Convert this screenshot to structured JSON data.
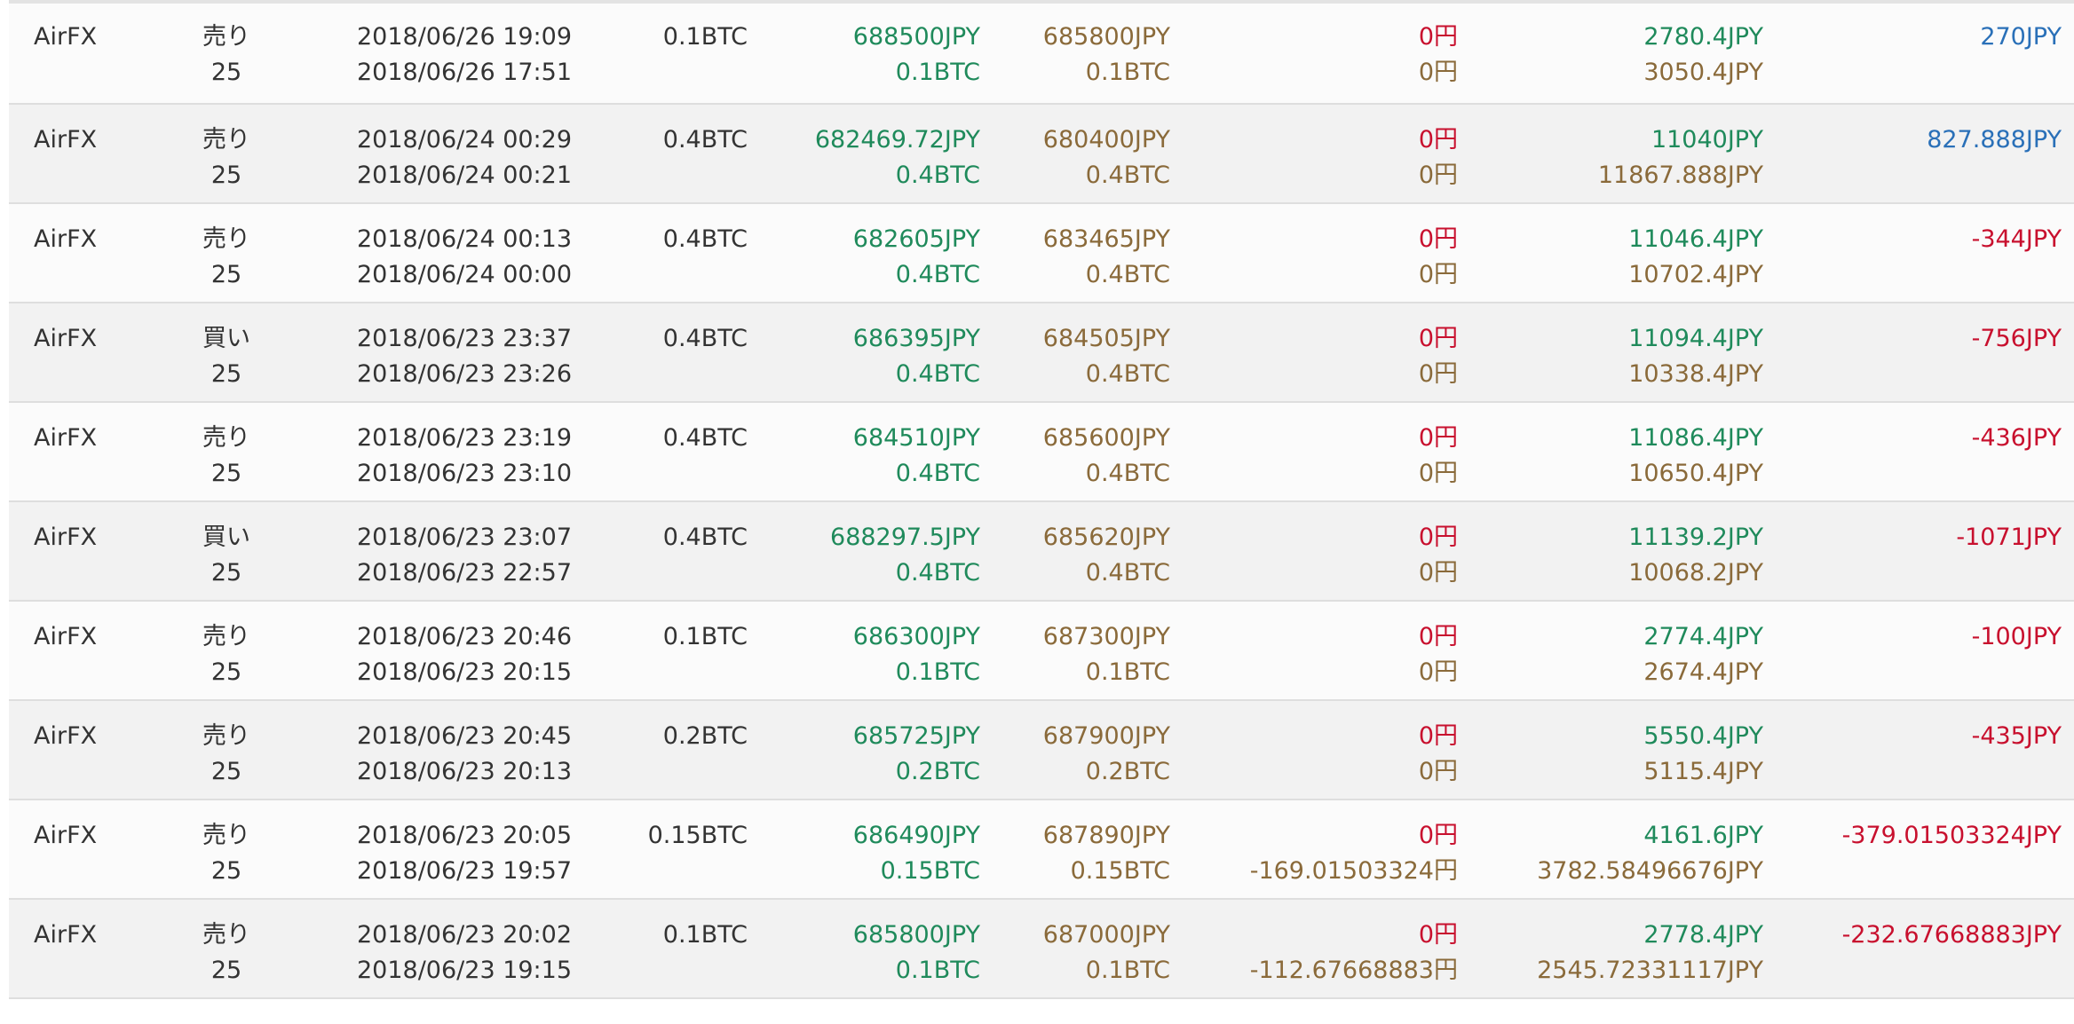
{
  "colors": {
    "text": "#333333",
    "green": "#1f8a5b",
    "brown": "#8a6a3a",
    "red": "#c8102e",
    "blue": "#2a70b8",
    "row_odd": "#fbfbfb",
    "row_even": "#f2f2f2",
    "divider": "#dedede"
  },
  "rows": [
    {
      "exchange": "AirFX",
      "side": "売り",
      "leverage": "25",
      "date_close": "2018/06/26 19:09",
      "date_open": "2018/06/26 17:51",
      "amount": "0.1BTC",
      "price_open": "688500JPY",
      "amount_open": "0.1BTC",
      "price_close": "685800JPY",
      "amount_close": "0.1BTC",
      "fee": "0円",
      "swap": "0円",
      "value_open": "2780.4JPY",
      "value_close": "3050.4JPY",
      "pnl": "270JPY",
      "pnl_sign": "positive"
    },
    {
      "exchange": "AirFX",
      "side": "売り",
      "leverage": "25",
      "date_close": "2018/06/24 00:29",
      "date_open": "2018/06/24 00:21",
      "amount": "0.4BTC",
      "price_open": "682469.72JPY",
      "amount_open": "0.4BTC",
      "price_close": "680400JPY",
      "amount_close": "0.4BTC",
      "fee": "0円",
      "swap": "0円",
      "value_open": "11040JPY",
      "value_close": "11867.888JPY",
      "pnl": "827.888JPY",
      "pnl_sign": "positive"
    },
    {
      "exchange": "AirFX",
      "side": "売り",
      "leverage": "25",
      "date_close": "2018/06/24 00:13",
      "date_open": "2018/06/24 00:00",
      "amount": "0.4BTC",
      "price_open": "682605JPY",
      "amount_open": "0.4BTC",
      "price_close": "683465JPY",
      "amount_close": "0.4BTC",
      "fee": "0円",
      "swap": "0円",
      "value_open": "11046.4JPY",
      "value_close": "10702.4JPY",
      "pnl": "-344JPY",
      "pnl_sign": "negative"
    },
    {
      "exchange": "AirFX",
      "side": "買い",
      "leverage": "25",
      "date_close": "2018/06/23 23:37",
      "date_open": "2018/06/23 23:26",
      "amount": "0.4BTC",
      "price_open": "686395JPY",
      "amount_open": "0.4BTC",
      "price_close": "684505JPY",
      "amount_close": "0.4BTC",
      "fee": "0円",
      "swap": "0円",
      "value_open": "11094.4JPY",
      "value_close": "10338.4JPY",
      "pnl": "-756JPY",
      "pnl_sign": "negative"
    },
    {
      "exchange": "AirFX",
      "side": "売り",
      "leverage": "25",
      "date_close": "2018/06/23 23:19",
      "date_open": "2018/06/23 23:10",
      "amount": "0.4BTC",
      "price_open": "684510JPY",
      "amount_open": "0.4BTC",
      "price_close": "685600JPY",
      "amount_close": "0.4BTC",
      "fee": "0円",
      "swap": "0円",
      "value_open": "11086.4JPY",
      "value_close": "10650.4JPY",
      "pnl": "-436JPY",
      "pnl_sign": "negative"
    },
    {
      "exchange": "AirFX",
      "side": "買い",
      "leverage": "25",
      "date_close": "2018/06/23 23:07",
      "date_open": "2018/06/23 22:57",
      "amount": "0.4BTC",
      "price_open": "688297.5JPY",
      "amount_open": "0.4BTC",
      "price_close": "685620JPY",
      "amount_close": "0.4BTC",
      "fee": "0円",
      "swap": "0円",
      "value_open": "11139.2JPY",
      "value_close": "10068.2JPY",
      "pnl": "-1071JPY",
      "pnl_sign": "negative"
    },
    {
      "exchange": "AirFX",
      "side": "売り",
      "leverage": "25",
      "date_close": "2018/06/23 20:46",
      "date_open": "2018/06/23 20:15",
      "amount": "0.1BTC",
      "price_open": "686300JPY",
      "amount_open": "0.1BTC",
      "price_close": "687300JPY",
      "amount_close": "0.1BTC",
      "fee": "0円",
      "swap": "0円",
      "value_open": "2774.4JPY",
      "value_close": "2674.4JPY",
      "pnl": "-100JPY",
      "pnl_sign": "negative"
    },
    {
      "exchange": "AirFX",
      "side": "売り",
      "leverage": "25",
      "date_close": "2018/06/23 20:45",
      "date_open": "2018/06/23 20:13",
      "amount": "0.2BTC",
      "price_open": "685725JPY",
      "amount_open": "0.2BTC",
      "price_close": "687900JPY",
      "amount_close": "0.2BTC",
      "fee": "0円",
      "swap": "0円",
      "value_open": "5550.4JPY",
      "value_close": "5115.4JPY",
      "pnl": "-435JPY",
      "pnl_sign": "negative"
    },
    {
      "exchange": "AirFX",
      "side": "売り",
      "leverage": "25",
      "date_close": "2018/06/23 20:05",
      "date_open": "2018/06/23 19:57",
      "amount": "0.15BTC",
      "price_open": "686490JPY",
      "amount_open": "0.15BTC",
      "price_close": "687890JPY",
      "amount_close": "0.15BTC",
      "fee": "0円",
      "swap": "-169.01503324円",
      "value_open": "4161.6JPY",
      "value_close": "3782.58496676JPY",
      "pnl": "-379.01503324JPY",
      "pnl_sign": "negative"
    },
    {
      "exchange": "AirFX",
      "side": "売り",
      "leverage": "25",
      "date_close": "2018/06/23 20:02",
      "date_open": "2018/06/23 19:15",
      "amount": "0.1BTC",
      "price_open": "685800JPY",
      "amount_open": "0.1BTC",
      "price_close": "687000JPY",
      "amount_close": "0.1BTC",
      "fee": "0円",
      "swap": "-112.67668883円",
      "value_open": "2778.4JPY",
      "value_close": "2545.72331117JPY",
      "pnl": "-232.67668883JPY",
      "pnl_sign": "negative"
    }
  ]
}
